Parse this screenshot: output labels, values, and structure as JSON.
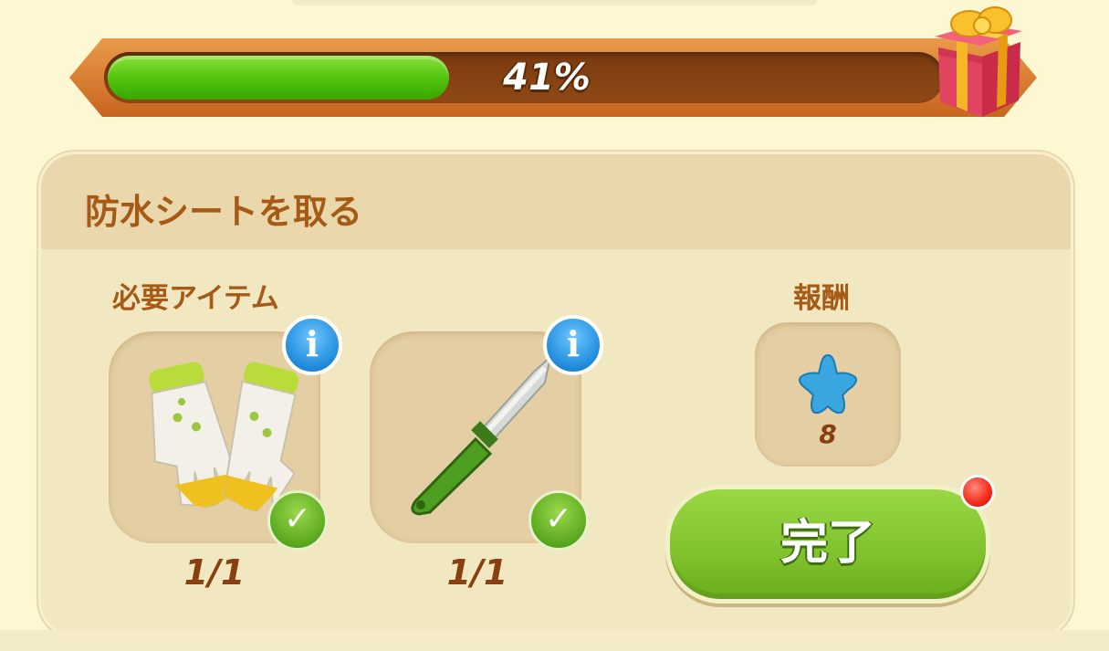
{
  "progress": {
    "percent_label": "41%",
    "fill_fraction": 0.41
  },
  "task": {
    "title": "防水シートを取る"
  },
  "required": {
    "label": "必要アイテム",
    "items": [
      {
        "name": "gloves",
        "count": "1/1",
        "info": "i",
        "check": "✓"
      },
      {
        "name": "knife",
        "count": "1/1",
        "info": "i",
        "check": "✓"
      }
    ]
  },
  "reward": {
    "label": "報酬",
    "amount": "8"
  },
  "complete_button": {
    "label": "完了"
  },
  "colors": {
    "accent_green": "#7fc22d",
    "brown_text": "#a55a16",
    "info_blue": "#1f8bdc"
  }
}
